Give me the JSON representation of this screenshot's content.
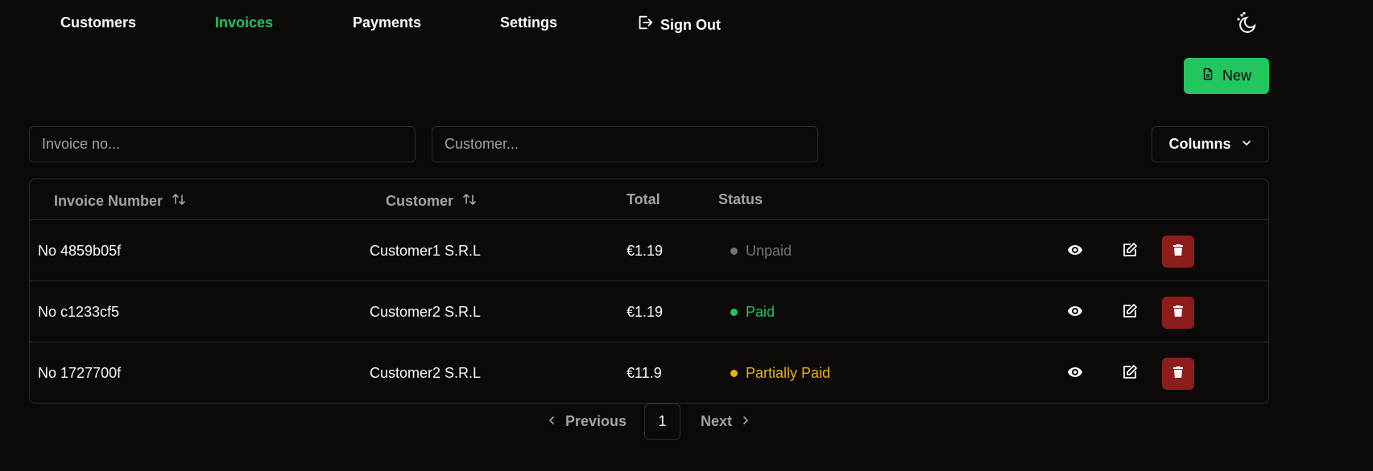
{
  "nav": {
    "items": [
      {
        "label": "Customers",
        "active": false
      },
      {
        "label": "Invoices",
        "active": true
      },
      {
        "label": "Payments",
        "active": false
      },
      {
        "label": "Settings",
        "active": false
      }
    ],
    "sign_out": "Sign Out"
  },
  "toolbar": {
    "new_label": "New",
    "columns_label": "Columns"
  },
  "filters": {
    "invoice_placeholder": "Invoice no...",
    "customer_placeholder": "Customer..."
  },
  "table": {
    "columns": [
      "Invoice Number",
      "Customer",
      "Total",
      "Status"
    ],
    "rows": [
      {
        "invoice": "No 4859b05f",
        "customer": "Customer1 S.R.L",
        "total": "€1.19",
        "status": "Unpaid",
        "status_color": "#78716c"
      },
      {
        "invoice": "No c1233cf5",
        "customer": "Customer2 S.R.L",
        "total": "€1.19",
        "status": "Paid",
        "status_color": "#22c55e"
      },
      {
        "invoice": "No 1727700f",
        "customer": "Customer2 S.R.L",
        "total": "€11.9",
        "status": "Partially Paid",
        "status_color": "#eab308"
      }
    ]
  },
  "pagination": {
    "previous": "Previous",
    "page": "1",
    "next": "Next"
  },
  "colors": {
    "accent": "#22c55e",
    "danger": "#8b1d1d",
    "background": "#0b0a09"
  },
  "icons": [
    "sign-out-icon",
    "theme-toggle-icon",
    "file-icon",
    "chevron-down-icon",
    "sort-icon",
    "eye-icon",
    "edit-icon",
    "trash-icon",
    "chevron-left-icon",
    "chevron-right-icon"
  ]
}
